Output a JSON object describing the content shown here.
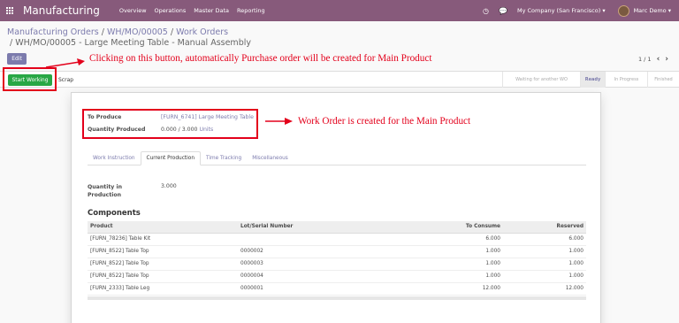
{
  "navbar": {
    "app_name": "Manufacturing",
    "menu": [
      "Overview",
      "Operations",
      "Master Data",
      "Reporting"
    ],
    "company": "My Company (San Francisco)",
    "user": "Marc Demo"
  },
  "breadcrumb": {
    "items": [
      "Manufacturing Orders",
      "WH/MO/00005",
      "Work Orders"
    ],
    "separator": " / ",
    "current": "WH/MO/00005 - Large Meeting Table - Manual Assembly"
  },
  "buttons": {
    "edit": "Edit",
    "start_working": "Start Working",
    "scrap": "Scrap"
  },
  "pager": {
    "text": "1 / 1"
  },
  "stages": [
    {
      "label": "Waiting for another WO",
      "active": false
    },
    {
      "label": "Ready",
      "active": true
    },
    {
      "label": "In Progress",
      "active": false
    },
    {
      "label": "Finished",
      "active": false
    }
  ],
  "annotations": {
    "button_note": "Clicking on this button, automatically Purchase order will be created for Main Product",
    "workorder_note": "Work Order is created for the Main Product",
    "color": "#e3001b"
  },
  "form": {
    "to_produce_label": "To Produce",
    "to_produce_value": "[FURN_6741] Large Meeting Table",
    "qty_produced_label": "Quantity Produced",
    "qty_produced_value": "0.000",
    "qty_separator": " / ",
    "qty_target": "3.000",
    "qty_unit": "Units",
    "qty_in_production_label_1": "Quantity in",
    "qty_in_production_label_2": "Production",
    "qty_in_production_value": "3.000"
  },
  "tabs": [
    "Work Instruction",
    "Current Production",
    "Time Tracking",
    "Miscellaneous"
  ],
  "components": {
    "title": "Components",
    "columns": [
      "Product",
      "Lot/Serial Number",
      "To Consume",
      "Reserved"
    ],
    "rows": [
      [
        "[FURN_78236] Table Kit",
        "",
        "6.000",
        "6.000"
      ],
      [
        "[FURN_8522] Table Top",
        "0000002",
        "1.000",
        "1.000"
      ],
      [
        "[FURN_8522] Table Top",
        "0000003",
        "1.000",
        "1.000"
      ],
      [
        "[FURN_8522] Table Top",
        "0000004",
        "1.000",
        "1.000"
      ],
      [
        "[FURN_2333] Table Leg",
        "0000001",
        "12.000",
        "12.000"
      ]
    ]
  },
  "colors": {
    "navbar": "#875a7b",
    "primary": "#7c7bad",
    "start_button": "#28a745"
  }
}
